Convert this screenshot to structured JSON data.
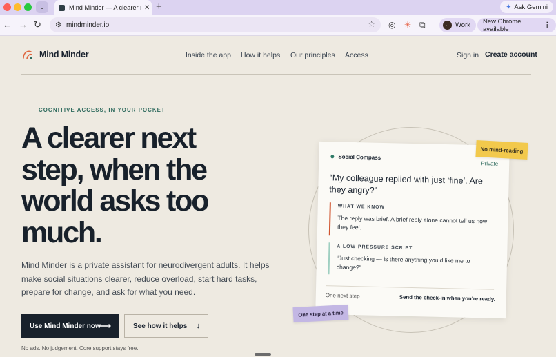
{
  "browser": {
    "tab_title": "Mind Minder — A clearer next",
    "url": "mindminder.io",
    "profile_initial": "J",
    "profile_label": "Work",
    "update_label": "New Chrome available",
    "gemini_label": "Ask Gemini"
  },
  "site": {
    "brand": "Mind Minder",
    "nav": [
      "Inside the app",
      "How it helps",
      "Our principles",
      "Access"
    ],
    "sign_in": "Sign in",
    "create_account": "Create account"
  },
  "hero": {
    "eyebrow": "COGNITIVE ACCESS, IN YOUR POCKET",
    "title": "A clearer next step, when the world asks too much.",
    "description": "Mind Minder is a private assistant for neurodivergent adults. It helps make social situations clearer, reduce overload, start hard tasks, prepare for change, and ask for what you need.",
    "primary_cta": "Use Mind Minder now",
    "secondary_cta": "See how it helps",
    "footnote": "No ads. No judgement. Core support stays free."
  },
  "card": {
    "app_name": "Social Compass",
    "privacy": "Private",
    "quote": "“My colleague replied with just ‘fine’. Are they angry?”",
    "sections": [
      {
        "label": "WHAT WE KNOW",
        "body": "The reply was brief. A brief reply alone cannot tell us how they feel.",
        "accent": "#d0542f"
      },
      {
        "label": "A LOW-PRESSURE SCRIPT",
        "body": "“Just checking — is there anything you’d like me to change?”",
        "accent": "#9fcfc1"
      }
    ],
    "footer_left": "One next step",
    "footer_right": "Send the check-in when you’re ready.",
    "sticky_top": "No mind-reading",
    "sticky_bottom": "One step at a time"
  },
  "colors": {
    "page_bg": "#eeeae1",
    "ink": "#18212b",
    "accent_green": "#2f6b5e",
    "sticky_yellow": "#f2c94c",
    "sticky_lavender": "#c3b7e4"
  }
}
